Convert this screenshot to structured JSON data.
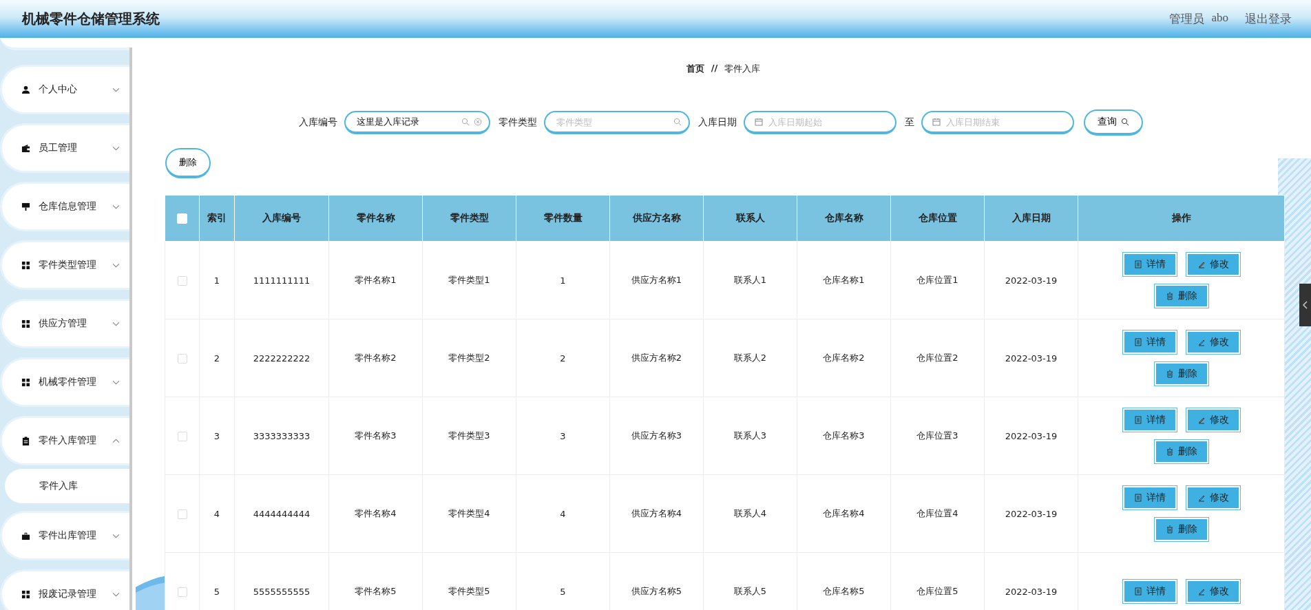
{
  "header": {
    "title": "机械零件仓储管理系统",
    "user_role": "管理员",
    "user_name": "abo",
    "logout": "退出登录"
  },
  "sidebar": {
    "items": [
      {
        "label": "个人中心",
        "kind": "user",
        "expanded": false
      },
      {
        "label": "员工管理",
        "kind": "wallet",
        "expanded": false
      },
      {
        "label": "仓库信息管理",
        "kind": "sign",
        "expanded": false
      },
      {
        "label": "零件类型管理",
        "kind": "grid",
        "expanded": false
      },
      {
        "label": "供应方管理",
        "kind": "grid",
        "expanded": false
      },
      {
        "label": "机械零件管理",
        "kind": "grid",
        "expanded": false
      },
      {
        "label": "零件入库管理",
        "kind": "clipboard",
        "expanded": true,
        "children": [
          {
            "label": "零件入库"
          }
        ]
      },
      {
        "label": "零件出库管理",
        "kind": "briefcase",
        "expanded": false
      },
      {
        "label": "报废记录管理",
        "kind": "grid",
        "expanded": false
      }
    ]
  },
  "breadcrumb": {
    "home": "首页",
    "separator": "//",
    "current": "零件入库"
  },
  "search": {
    "fields": [
      {
        "label": "入库编号",
        "kind": "text",
        "value": "这里是入库记录",
        "clearable": true
      },
      {
        "label": "零件类型",
        "kind": "text",
        "placeholder": "零件类型",
        "clearable": false
      },
      {
        "label": "入库日期",
        "kind": "date",
        "placeholder": "入库日期起始",
        "clearable": false
      },
      {
        "label": "至",
        "kind": "date",
        "placeholder": "入库日期结束",
        "clearable": false
      }
    ],
    "button": "查询"
  },
  "toolbar": {
    "delete_button": "删除"
  },
  "table": {
    "select_all_checked": false,
    "columns": [
      "索引",
      "入库编号",
      "零件名称",
      "零件类型",
      "零件数量",
      "供应方名称",
      "联系人",
      "仓库名称",
      "仓库位置",
      "入库日期",
      "操作"
    ],
    "rows": [
      {
        "checked": false,
        "cells": [
          "1",
          "1111111111",
          "零件名称1",
          "零件类型1",
          "1",
          "供应方名称1",
          "联系人1",
          "仓库名称1",
          "仓库位置1",
          "2022-03-19"
        ],
        "actions": [
          {
            "kind": "detail",
            "label": "详情"
          },
          {
            "kind": "edit",
            "label": "修改"
          },
          {
            "kind": "delete",
            "label": "删除"
          }
        ]
      },
      {
        "checked": false,
        "cells": [
          "2",
          "2222222222",
          "零件名称2",
          "零件类型2",
          "2",
          "供应方名称2",
          "联系人2",
          "仓库名称2",
          "仓库位置2",
          "2022-03-19"
        ],
        "actions": [
          {
            "kind": "detail",
            "label": "详情"
          },
          {
            "kind": "edit",
            "label": "修改"
          },
          {
            "kind": "delete",
            "label": "删除"
          }
        ]
      },
      {
        "checked": false,
        "cells": [
          "3",
          "3333333333",
          "零件名称3",
          "零件类型3",
          "3",
          "供应方名称3",
          "联系人3",
          "仓库名称3",
          "仓库位置3",
          "2022-03-19"
        ],
        "actions": [
          {
            "kind": "detail",
            "label": "详情"
          },
          {
            "kind": "edit",
            "label": "修改"
          },
          {
            "kind": "delete",
            "label": "删除"
          }
        ]
      },
      {
        "checked": false,
        "cells": [
          "4",
          "4444444444",
          "零件名称4",
          "零件类型4",
          "4",
          "供应方名称4",
          "联系人4",
          "仓库名称4",
          "仓库位置4",
          "2022-03-19"
        ],
        "actions": [
          {
            "kind": "detail",
            "label": "详情"
          },
          {
            "kind": "edit",
            "label": "修改"
          },
          {
            "kind": "delete",
            "label": "删除"
          }
        ]
      },
      {
        "checked": false,
        "cells": [
          "5",
          "5555555555",
          "零件名称5",
          "零件类型5",
          "5",
          "供应方名称5",
          "联系人5",
          "仓库名称5",
          "仓库位置5",
          "2022-03-19"
        ],
        "actions": [
          {
            "kind": "detail",
            "label": "详情"
          },
          {
            "kind": "edit",
            "label": "修改"
          }
        ]
      }
    ]
  }
}
